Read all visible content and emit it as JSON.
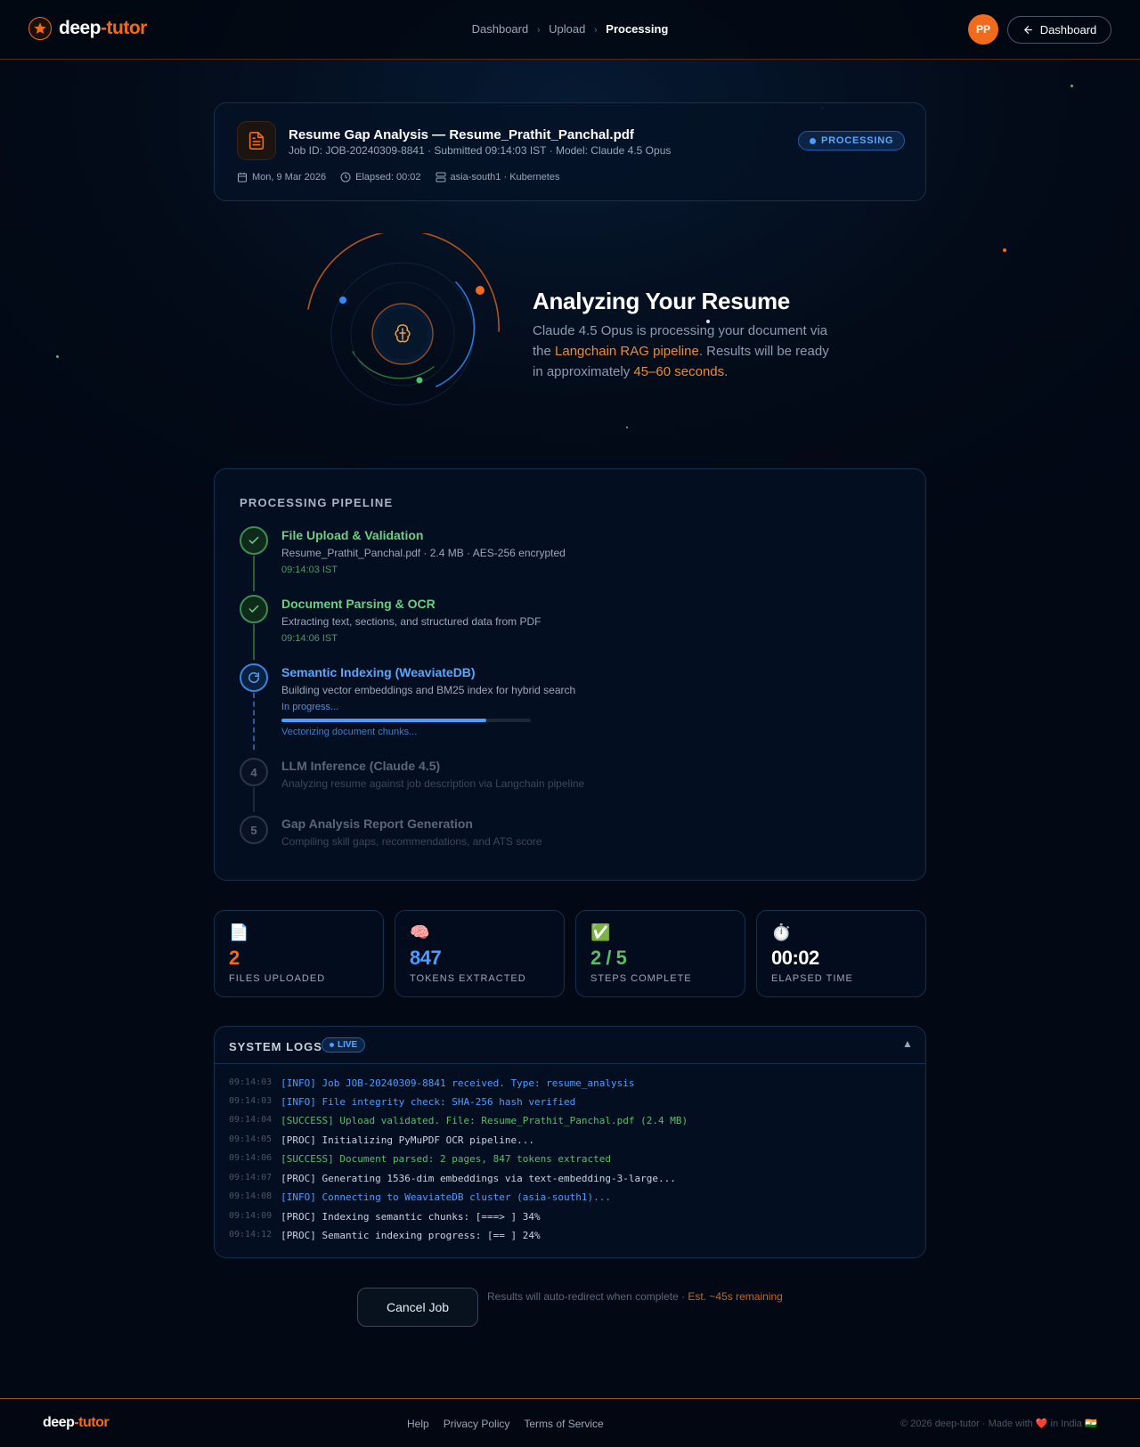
{
  "header": {
    "logo_part1": "deep",
    "logo_part2": "-tutor",
    "breadcrumb": [
      "Dashboard",
      "Upload",
      "Processing"
    ],
    "avatar_initials": "PP",
    "dashboard_button": "Dashboard"
  },
  "job": {
    "title": "Resume Gap Analysis — Resume_Prathit_Panchal.pdf",
    "subtitle": "Job ID: JOB-20240309-8841 · Submitted 09:14:03 IST · Model: Claude 4.5 Opus",
    "status": "PROCESSING",
    "date": "Mon, 9 Mar 2026",
    "elapsed": "Elapsed: 00:02",
    "region": "asia-south1 · Kubernetes"
  },
  "hero": {
    "title": "Analyzing Your Resume",
    "desc_1": "Claude 4.5 Opus is processing your document via the ",
    "desc_hl1": "Langchain RAG pipeline",
    "desc_2": ". Results will be ready in approximately ",
    "desc_hl2": "45–60 seconds",
    "desc_3": "."
  },
  "pipeline": {
    "title": "PROCESSING PIPELINE",
    "steps": [
      {
        "title": "File Upload & Validation",
        "desc": "Resume_Prathit_Panchal.pdf · 2.4 MB · AES-256 encrypted",
        "status": "09:14:03 IST",
        "state": "done"
      },
      {
        "title": "Document Parsing & OCR",
        "desc": "Extracting text, sections, and structured data from PDF",
        "status": "09:14:06 IST",
        "state": "done"
      },
      {
        "title": "Semantic Indexing (WeaviateDB)",
        "desc": "Building vector embeddings and BM25 index for hybrid search",
        "status": "In progress...",
        "state": "active",
        "progress": 0.82,
        "progress_label": "Vectorizing document chunks..."
      },
      {
        "number": "4",
        "title": "LLM Inference (Claude 4.5)",
        "desc": "Analyzing resume against job description via Langchain pipeline",
        "state": "pending"
      },
      {
        "number": "5",
        "title": "Gap Analysis Report Generation",
        "desc": "Compiling skill gaps, recommendations, and ATS score",
        "state": "pending"
      }
    ]
  },
  "stats": [
    {
      "icon": "📄",
      "value": "2",
      "label": "FILES UPLOADED",
      "color": "#f26b1d"
    },
    {
      "icon": "🧠",
      "value": "847",
      "label": "TOKENS EXTRACTED",
      "color": "#4d9cff"
    },
    {
      "icon": "✅",
      "value": "2 / 5",
      "label": "STEPS COMPLETE",
      "color": "#5cba6d"
    },
    {
      "icon": "⏱️",
      "value": "00:02",
      "label": "ELAPSED TIME",
      "color": "#ffffff"
    }
  ],
  "logs": {
    "title": "SYSTEM LOGS",
    "live": "LIVE",
    "entries": [
      {
        "time": "09:14:03",
        "text": "[INFO] Job JOB-20240309-8841 received. Type: resume_analysis",
        "level": "info"
      },
      {
        "time": "09:14:03",
        "text": "[INFO] File integrity check: SHA-256 hash verified",
        "level": "info"
      },
      {
        "time": "09:14:04",
        "text": "[SUCCESS] Upload validated. File: Resume_Prathit_Panchal.pdf (2.4 MB)",
        "level": "succ"
      },
      {
        "time": "09:14:05",
        "text": "[PROC] Initializing PyMuPDF OCR pipeline...",
        "level": "proc"
      },
      {
        "time": "09:14:06",
        "text": "[SUCCESS] Document parsed: 2 pages, 847 tokens extracted",
        "level": "succ"
      },
      {
        "time": "09:14:07",
        "text": "[PROC] Generating 1536-dim embeddings via text-embedding-3-large...",
        "level": "proc"
      },
      {
        "time": "09:14:08",
        "text": "[INFO] Connecting to WeaviateDB cluster (asia-south1)...",
        "level": "info"
      },
      {
        "time": "09:14:09",
        "text": "[PROC] Indexing semantic chunks: [===> ] 34%",
        "level": "proc"
      },
      {
        "time": "09:14:12",
        "text": "[PROC] Semantic indexing progress: [== ] 24%",
        "level": "proc"
      }
    ]
  },
  "actions": {
    "cancel": "Cancel Job",
    "redirect_text": "Results will auto-redirect when complete · ",
    "redirect_hl": "Est. ~45s remaining"
  },
  "footer": {
    "logo_part1": "deep",
    "logo_part2": "-tutor",
    "links": [
      "Help",
      "Privacy Policy",
      "Terms of Service"
    ],
    "copyright": "© 2026 deep-tutor · Made with ❤️ in India 🇮🇳"
  }
}
